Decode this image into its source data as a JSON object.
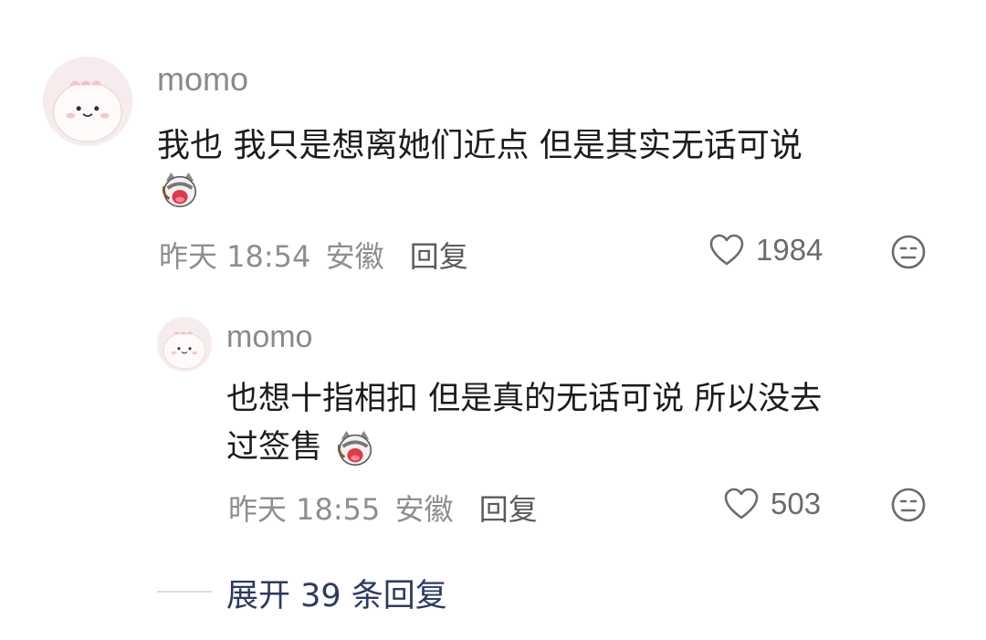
{
  "comment": {
    "username": "momo",
    "text": "我也 我只是想离她们近点 但是其实无话可说",
    "emoji": "cat-crying-emoji",
    "time": "昨天 18:54",
    "location": "安徽",
    "reply_label": "回复",
    "likes": "1984"
  },
  "reply": {
    "username": "momo",
    "text_line1": "也想十指相扣 但是真的无话可说 所以没去",
    "text_line2": "过签售",
    "emoji": "cat-crying-emoji",
    "time": "昨天 18:55",
    "location": "安徽",
    "reply_label": "回复",
    "likes": "503"
  },
  "expand": {
    "label": "展开 39 条回复"
  }
}
